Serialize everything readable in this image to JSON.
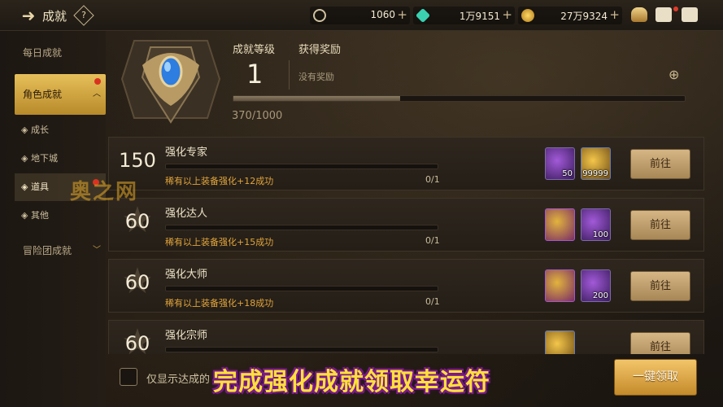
{
  "topbar": {
    "title": "成就",
    "help": "?",
    "currencies": [
      {
        "icon": "credit-coin-icon",
        "value": "1060",
        "color": "#cfc2a0"
      },
      {
        "icon": "crystal-icon",
        "value": "1万9151",
        "color": "#3ad0b0"
      },
      {
        "icon": "gold-coin-icon",
        "value": "27万9324",
        "color": "#e6b43a"
      }
    ],
    "plus": "+",
    "icons": [
      "bag-icon",
      "mail-icon",
      "chat-icon"
    ]
  },
  "sidebar": {
    "daily": "每日成就",
    "character": "角色成就",
    "sub_items": [
      "成长",
      "地下城",
      "道具",
      "其他"
    ],
    "adventure": "冒险团成就"
  },
  "header": {
    "level_label": "成就等级",
    "level_value": "1",
    "reward_label": "获得奖励",
    "reward_value": "没有奖励",
    "progress_text": "370/1000",
    "progress_fraction": 0.37
  },
  "achievements": [
    {
      "points": "150",
      "title": "强化专家",
      "desc": "稀有以上装备强化+12成功",
      "count": "0/1",
      "rewards": [
        {
          "type": "purple",
          "qty": "50"
        },
        {
          "type": "gold",
          "qty": "99999"
        }
      ],
      "button": "前往"
    },
    {
      "points": "60",
      "title": "强化达人",
      "desc": "稀有以上装备强化+15成功",
      "count": "0/1",
      "rewards": [
        {
          "type": "book",
          "qty": ""
        },
        {
          "type": "purple",
          "qty": "100"
        }
      ],
      "button": "前往"
    },
    {
      "points": "60",
      "title": "强化大师",
      "desc": "稀有以上装备强化+18成功",
      "count": "0/1",
      "rewards": [
        {
          "type": "book",
          "qty": ""
        },
        {
          "type": "purple",
          "qty": "200"
        }
      ],
      "button": "前往"
    },
    {
      "points": "60",
      "title": "强化宗师",
      "desc": "",
      "count": "",
      "rewards": [
        {
          "type": "gold",
          "qty": ""
        }
      ],
      "button": "前往"
    }
  ],
  "footer": {
    "checkbox_label": "仅显示达成的",
    "claim_all": "一键领取"
  },
  "caption": "完成强化成就领取幸运符",
  "watermark": "奥之网"
}
